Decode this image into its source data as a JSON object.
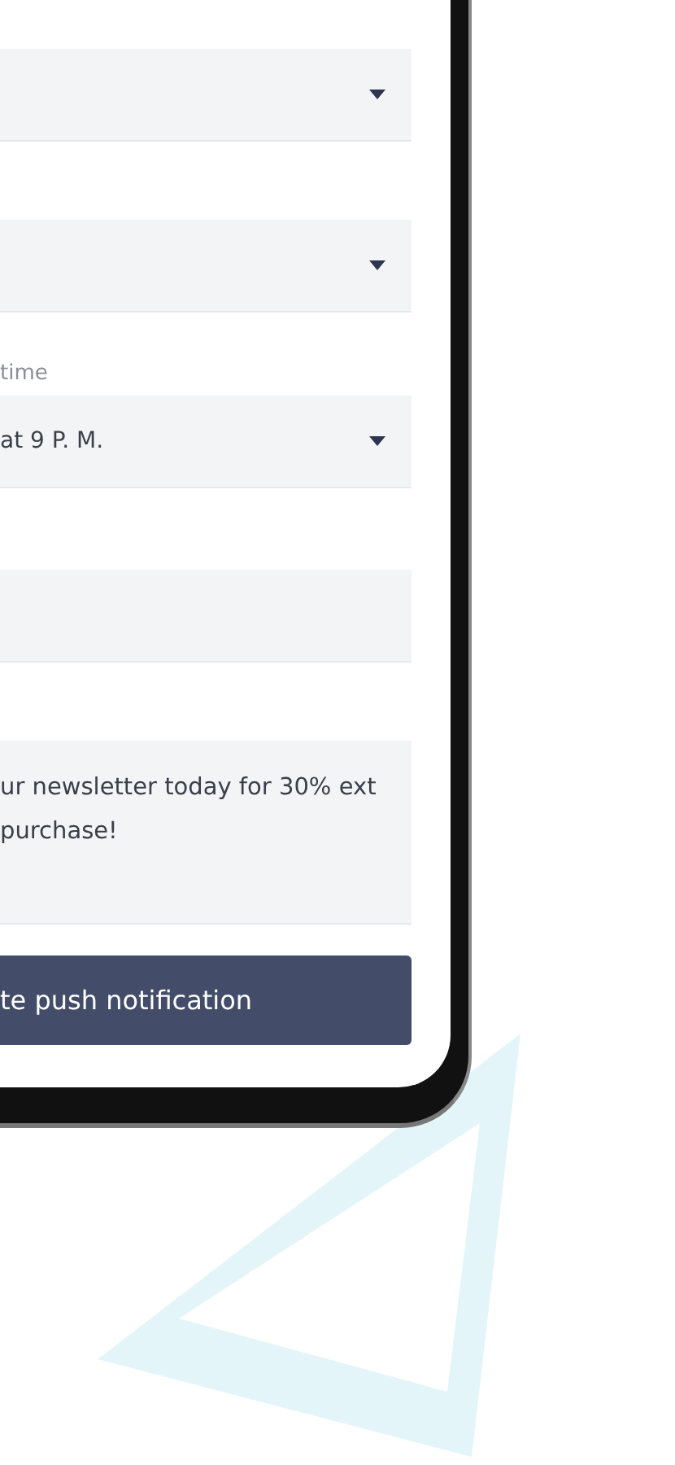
{
  "form": {
    "fields": [
      {
        "kind": "select"
      },
      {
        "kind": "select"
      },
      {
        "kind": "select",
        "label": "time",
        "value": "at 9 P. M."
      },
      {
        "kind": "input"
      },
      {
        "kind": "textarea",
        "value": "ur newsletter today for 30% ext purchase!"
      }
    ],
    "submit_button": "te push notification"
  }
}
